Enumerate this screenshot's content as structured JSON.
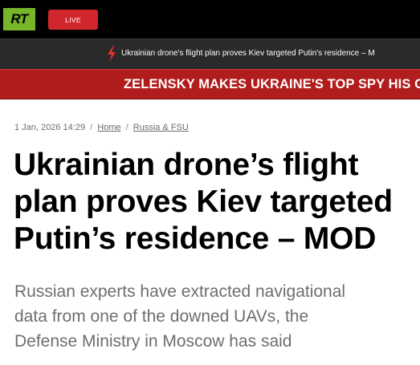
{
  "header": {
    "logo_text": "RT",
    "logo_color": "#77b52a",
    "live_label": "LIVE",
    "live_color": "#d1272c"
  },
  "ticker": {
    "icon": "lightning-bolt-icon",
    "text": "Ukrainian drone's flight plan proves Kiev targeted Putin's residence – M"
  },
  "breaking": {
    "text": "ZELENSKY MAKES UKRAINE'S TOP SPY HIS C",
    "color": "#b11c1c"
  },
  "article": {
    "date": "1 Jan, 2026 14:29",
    "breadcrumb": [
      "Home",
      "Russia & FSU"
    ],
    "headline_lines": [
      "Ukrainian drone’s flight",
      "plan proves Kiev targeted",
      "Putin’s residence – MOD"
    ],
    "summary_lines": [
      "Russian experts have extracted navigational",
      "data from one of the downed UAVs, the",
      "Defense Ministry in Moscow has said"
    ]
  }
}
